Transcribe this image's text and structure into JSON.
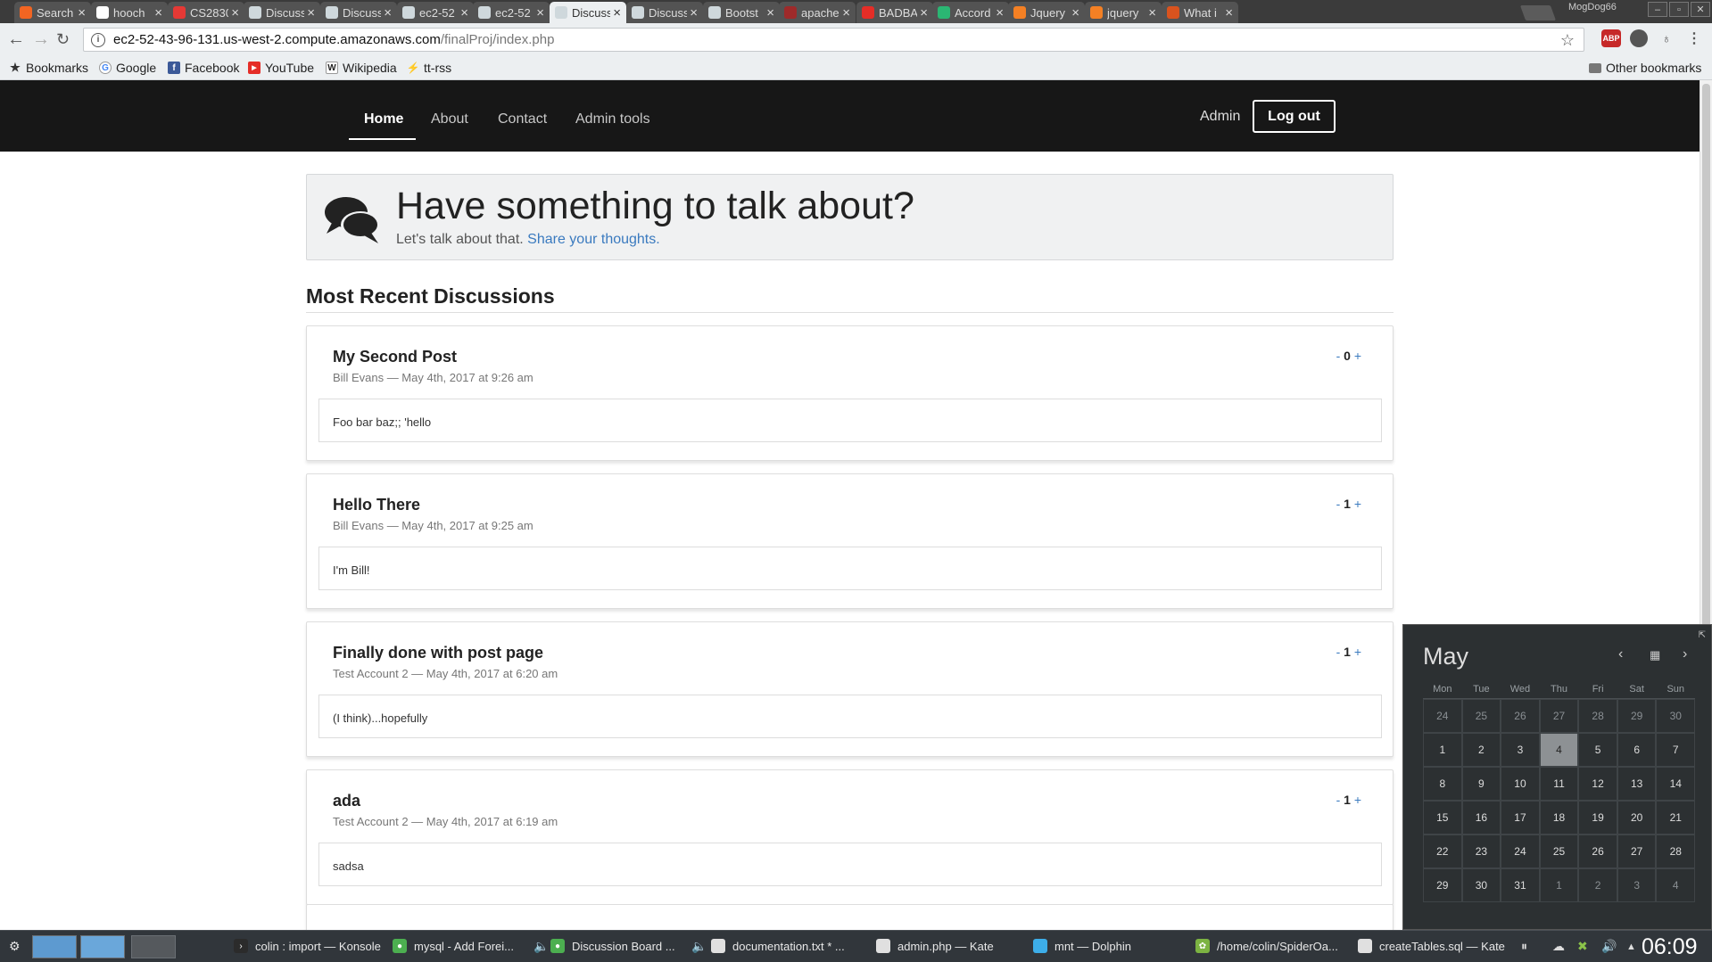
{
  "browser": {
    "tabs": [
      {
        "label": "Search",
        "color": "#f26522"
      },
      {
        "label": "hooch",
        "color": "#ffffff"
      },
      {
        "label": "CS2830",
        "color": "#e53935"
      },
      {
        "label": "Discuss",
        "color": "#cfd8dc"
      },
      {
        "label": "Discuss",
        "color": "#cfd8dc"
      },
      {
        "label": "ec2-52",
        "color": "#cfd8dc"
      },
      {
        "label": "ec2-52",
        "color": "#cfd8dc"
      },
      {
        "label": "Discuss",
        "color": "#cfd8dc"
      },
      {
        "label": "Discuss",
        "color": "#cfd8dc"
      },
      {
        "label": "Bootst",
        "color": "#cfd8dc"
      },
      {
        "label": "apache",
        "color": "#9e2a2a"
      },
      {
        "label": "BADBA",
        "color": "#e52d27"
      },
      {
        "label": "Accord",
        "color": "#2bb673"
      },
      {
        "label": "Jquery",
        "color": "#f48024"
      },
      {
        "label": "jquery",
        "color": "#f48024"
      },
      {
        "label": "What i",
        "color": "#d9531e"
      }
    ],
    "profile_name": "MogDog66",
    "url_host": "ec2-52-43-96-131.us-west-2.compute.amazonaws.com",
    "url_path": "/finalProj/index.php",
    "bookmarks": [
      "Bookmarks",
      "Google",
      "Facebook",
      "YouTube",
      "Wikipedia",
      "tt-rss"
    ],
    "other_bookmarks": "Other bookmarks",
    "extensions": [
      "ABP"
    ]
  },
  "site": {
    "nav": {
      "home": "Home",
      "about": "About",
      "contact": "Contact",
      "admin_tools": "Admin tools"
    },
    "user_label": "Admin",
    "logout_label": "Log out",
    "jumbotron": {
      "title": "Have something to talk about?",
      "subtitle": "Let's talk about that.",
      "link_text": "Share your thoughts."
    },
    "recent_heading": "Most Recent Discussions",
    "posts": [
      {
        "title": "My Second Post",
        "meta": "Bill Evans — May 4th, 2017 at 9:26 am",
        "minus": "-",
        "score": "0",
        "plus": "+",
        "body": "Foo bar baz;; 'hello"
      },
      {
        "title": "Hello There",
        "meta": "Bill Evans — May 4th, 2017 at 9:25 am",
        "minus": "-",
        "score": "1",
        "plus": "+",
        "body": "I'm Bill!"
      },
      {
        "title": "Finally done with post page",
        "meta": "Test Account 2 — May 4th, 2017 at 6:20 am",
        "minus": "-",
        "score": "1",
        "plus": "+",
        "body": "(I think)...hopefully"
      },
      {
        "title": "ada",
        "meta": "Test Account 2 — May 4th, 2017 at 6:19 am",
        "minus": "-",
        "score": "1",
        "plus": "+",
        "body": "sadsa"
      }
    ]
  },
  "calendar": {
    "month": "May",
    "weekdays": [
      "Mon",
      "Tue",
      "Wed",
      "Thu",
      "Fri",
      "Sat",
      "Sun"
    ],
    "weeks": [
      [
        "24",
        "25",
        "26",
        "27",
        "28",
        "29",
        "30"
      ],
      [
        "1",
        "2",
        "3",
        "4",
        "5",
        "6",
        "7"
      ],
      [
        "8",
        "9",
        "10",
        "11",
        "12",
        "13",
        "14"
      ],
      [
        "15",
        "16",
        "17",
        "18",
        "19",
        "20",
        "21"
      ],
      [
        "22",
        "23",
        "24",
        "25",
        "26",
        "27",
        "28"
      ],
      [
        "29",
        "30",
        "31",
        "1",
        "2",
        "3",
        "4"
      ]
    ],
    "today": "4"
  },
  "taskbar": {
    "items": [
      {
        "label": "colin : import — Konsole",
        "icon": "terminal-icon"
      },
      {
        "label": "mysql - Add Forei...",
        "icon": "chrome-icon"
      },
      {
        "label": "Discussion Board ...",
        "icon": "chrome-icon"
      },
      {
        "label": "documentation.txt * ...",
        "icon": "document-icon"
      },
      {
        "label": "admin.php — Kate",
        "icon": "document-icon"
      },
      {
        "label": "mnt — Dolphin",
        "icon": "folder-icon"
      },
      {
        "label": "/home/colin/SpiderOa...",
        "icon": "spideroak-icon"
      },
      {
        "label": "createTables.sql — Kate",
        "icon": "document-icon"
      }
    ],
    "clock": "06:09"
  }
}
